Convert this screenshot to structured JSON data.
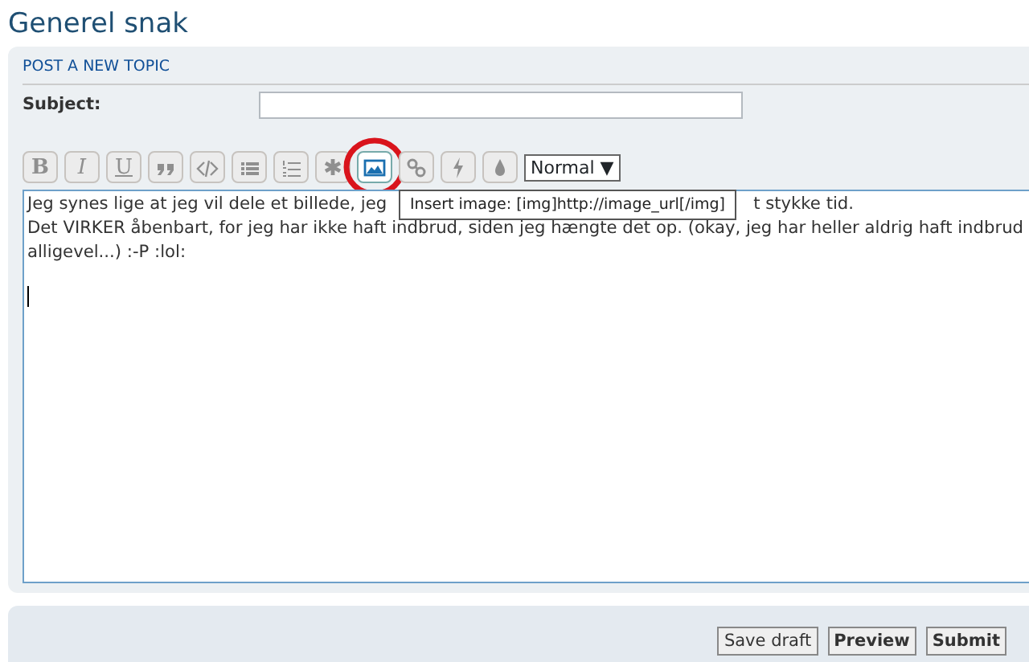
{
  "page_title": "Generel snak",
  "panel": {
    "heading": "POST A NEW TOPIC",
    "subject_label": "Subject:"
  },
  "toolbar": [
    {
      "kind": "text",
      "label": "B",
      "highlighted": false
    },
    {
      "kind": "text",
      "label": "I",
      "highlighted": false
    },
    {
      "kind": "text",
      "label": "U",
      "highlighted": false
    },
    {
      "kind": "icon",
      "highlighted": false
    },
    {
      "kind": "icon",
      "highlighted": false
    },
    {
      "kind": "icon",
      "highlighted": false
    },
    {
      "kind": "icon",
      "highlighted": false
    },
    {
      "kind": "icon",
      "highlighted": false
    },
    {
      "kind": "icon",
      "highlighted": true
    },
    {
      "kind": "icon",
      "highlighted": false
    },
    {
      "kind": "icon",
      "highlighted": false
    },
    {
      "kind": "icon",
      "highlighted": false
    }
  ],
  "font_size_select": "Normal ▼",
  "tooltip": "Insert image: [img]http://image_url[/img]",
  "editor_lines": [
    [
      "Jeg synes lige at jeg vil dele et billede, jeg",
      "t stykke tid."
    ],
    [
      "Det VIRKER åbenbart, for jeg har ikke haft indbrud, siden jeg hængte det op. (okay, jeg har heller aldrig haft indbrud"
    ],
    [
      "alligevel...)  :-P  :lol:"
    ]
  ],
  "buttons": [
    {
      "label": "Save draft",
      "primary": false
    },
    {
      "label": "Preview",
      "primary": true
    },
    {
      "label": "Submit",
      "primary": true
    }
  ]
}
